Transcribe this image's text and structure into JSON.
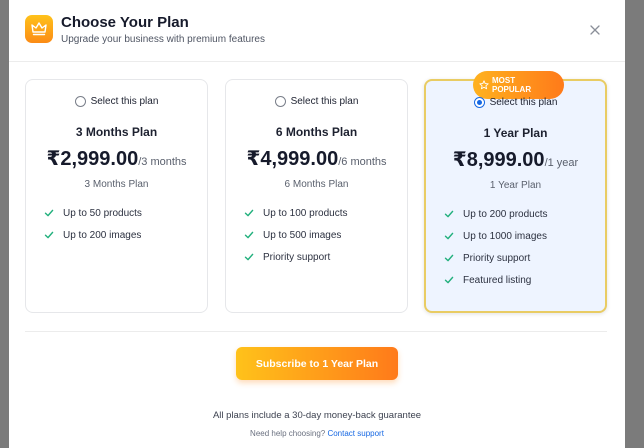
{
  "header": {
    "title": "Choose Your Plan",
    "subtitle": "Upgrade your business with premium features",
    "icon": "crown-icon",
    "close_icon": "close-icon"
  },
  "plans": [
    {
      "select_label": "Select this plan",
      "selected": false,
      "name": "3 Months Plan",
      "price": "₹2,999.00",
      "period": "/3 months",
      "caption": "3 Months Plan",
      "features": [
        "Up to 50 products",
        "Up to 200 images"
      ]
    },
    {
      "select_label": "Select this plan",
      "selected": false,
      "name": "6 Months Plan",
      "price": "₹4,999.00",
      "period": "/6 months",
      "caption": "6 Months Plan",
      "features": [
        "Up to 100 products",
        "Up to 500 images",
        "Priority support"
      ]
    },
    {
      "select_label": "Select this plan",
      "selected": true,
      "badge": "MOST POPULAR",
      "name": "1 Year Plan",
      "price": "₹8,999.00",
      "period": "/1 year",
      "caption": "1 Year Plan",
      "features": [
        "Up to 200 products",
        "Up to 1000 images",
        "Priority support",
        "Featured listing"
      ]
    }
  ],
  "subscribe_button": "Subscribe to 1 Year Plan",
  "footer": {
    "guarantee": "All plans include a 30-day money-back guarantee",
    "help_text": "Need help choosing?",
    "help_link": "Contact support"
  },
  "colors": {
    "accent_start": "#ffc21a",
    "accent_end": "#ff7a1a",
    "check": "#22b07d",
    "selected_radio": "#1668e3",
    "featured_bg": "#eef4ff"
  }
}
